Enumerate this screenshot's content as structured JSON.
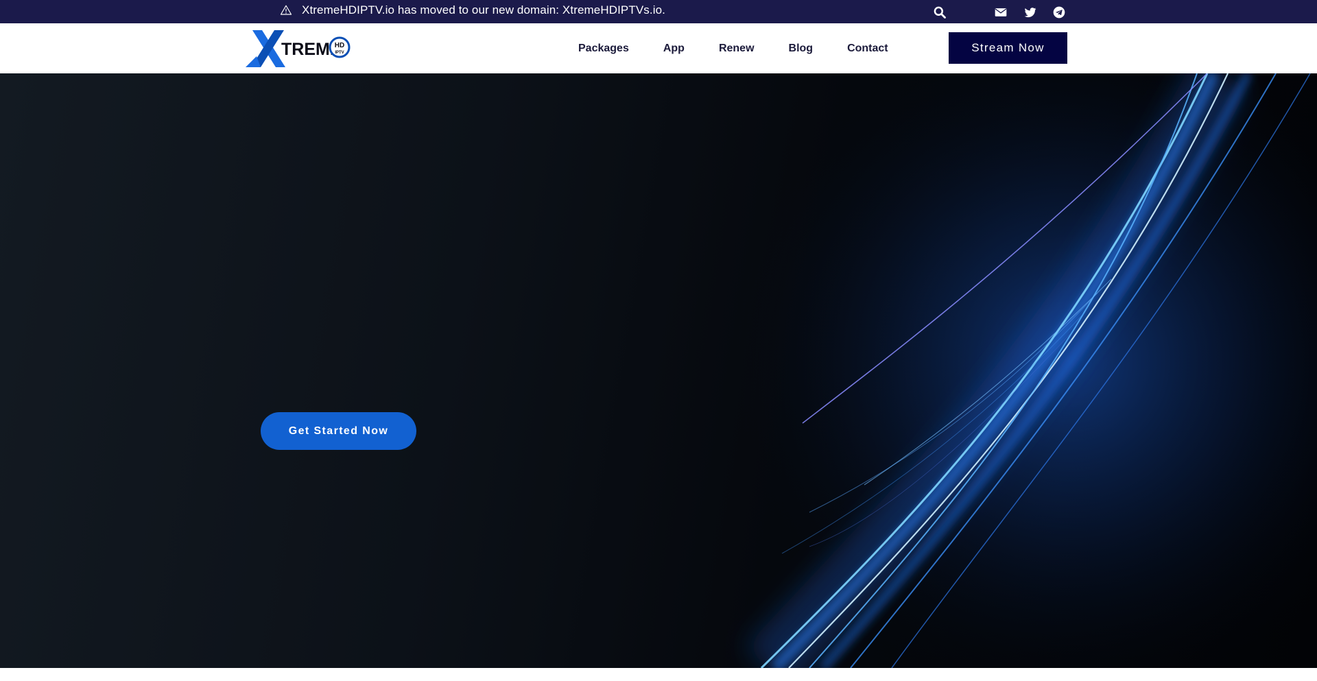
{
  "announcement": {
    "text": "XtremeHDIPTV.io has moved to our new domain: XtremeHDIPTVs.io.",
    "icon": "warning-icon"
  },
  "topbar_icons": [
    "search-icon",
    "mail-icon",
    "twitter-icon",
    "telegram-icon"
  ],
  "logo": {
    "wordmark": "TREME",
    "badge_top": "HD",
    "badge_bottom": "IPTV"
  },
  "nav": {
    "items": [
      {
        "label": "Packages"
      },
      {
        "label": "App"
      },
      {
        "label": "Renew"
      },
      {
        "label": "Blog"
      },
      {
        "label": "Contact"
      }
    ]
  },
  "header": {
    "stream_label": "Stream Now"
  },
  "hero": {
    "cta_label": "Get Started Now"
  },
  "colors": {
    "topbar_bg": "#1b1a4b",
    "stream_button_bg": "#040442",
    "cta_bg": "#1261d1",
    "brand_blue": "#1a6be0"
  }
}
